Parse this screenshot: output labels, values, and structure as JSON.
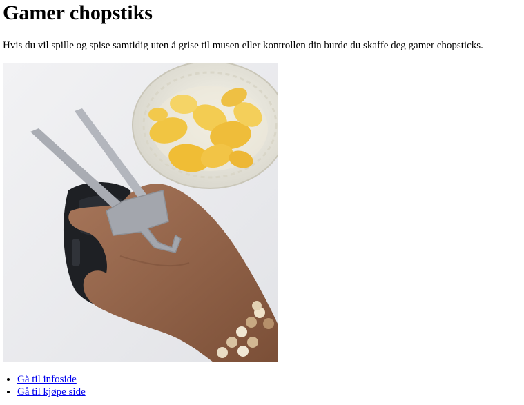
{
  "page": {
    "title": "Gamer chopstiks",
    "intro": "Hvis du vil spille og spise samtidig uten å grise til musen eller kontrollen din burde du skaffe deg gamer chopsticks."
  },
  "photo": {
    "subject": "hand-on-mouse-with-gamer-chopsticks"
  },
  "links": [
    {
      "label": "Gå til infoside"
    },
    {
      "label": "Gå til kjøpe side"
    }
  ]
}
